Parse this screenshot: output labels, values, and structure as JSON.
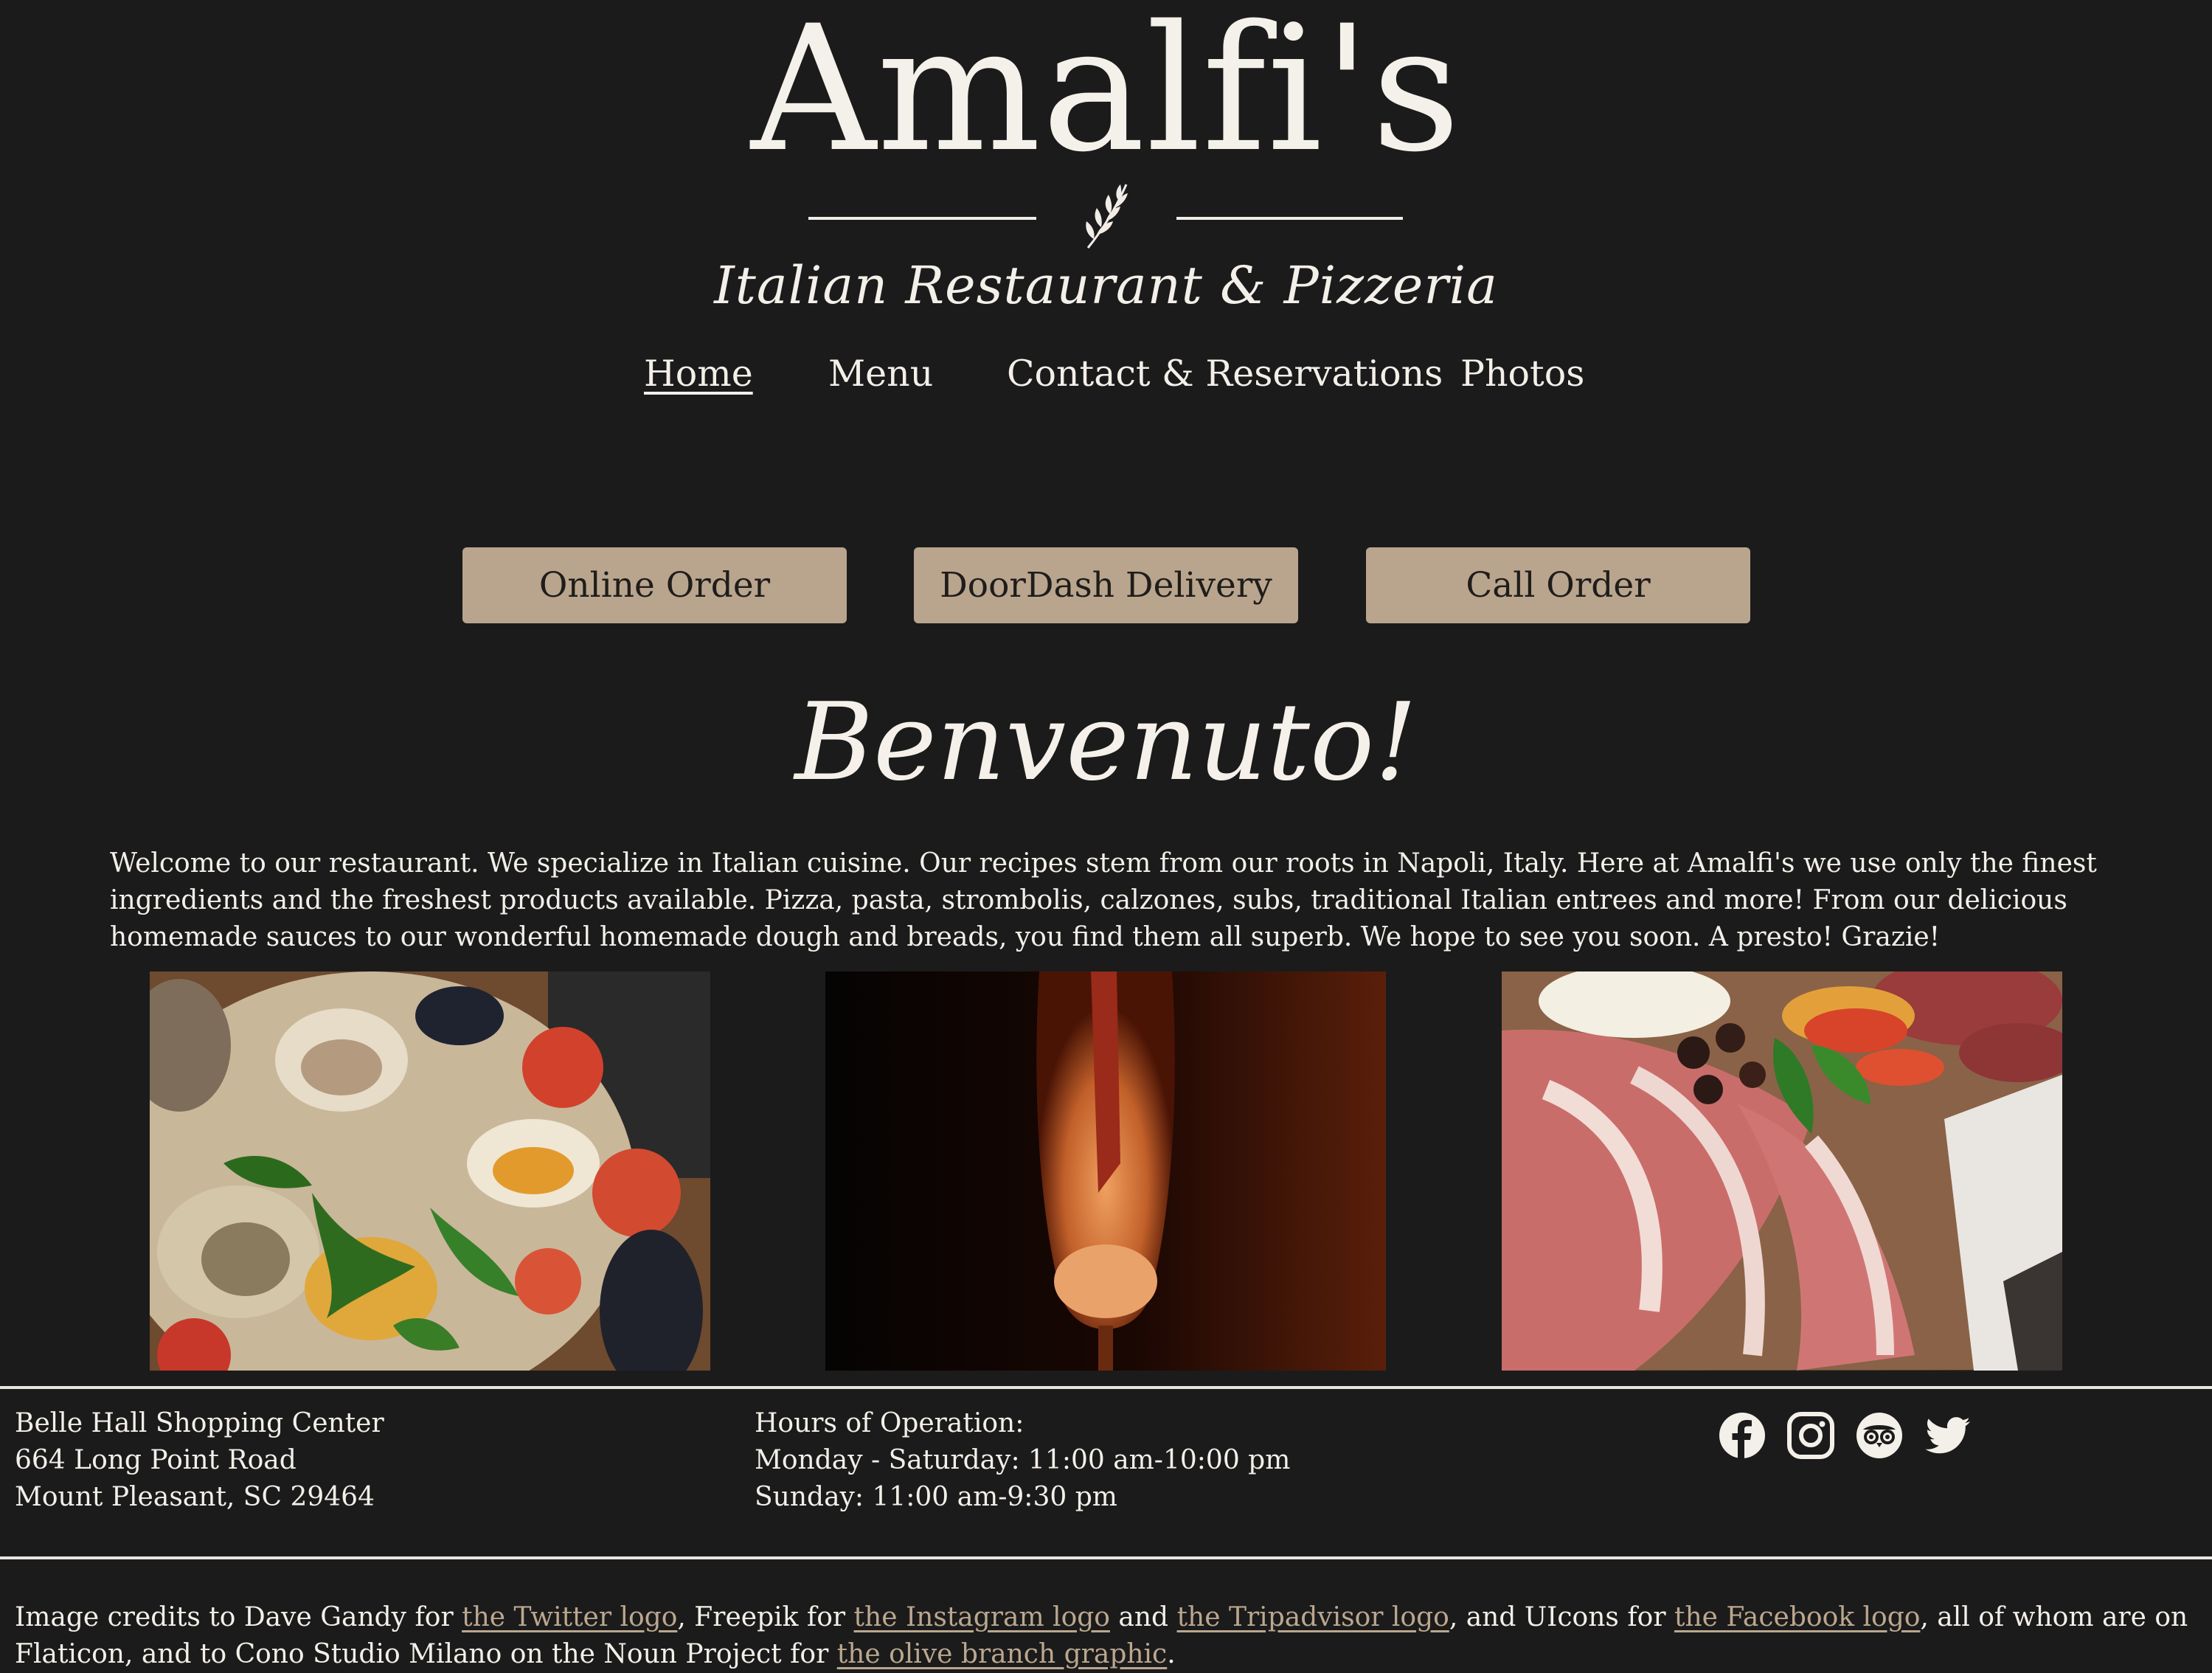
{
  "header": {
    "title": "Amalfi's",
    "tagline": "Italian Restaurant & Pizzeria"
  },
  "nav": {
    "home": "Home",
    "menu": "Menu",
    "contact": "Contact & Reservations",
    "photos": "Photos",
    "active": "Home"
  },
  "order_buttons": {
    "online": "Online Order",
    "doordash": "DoorDash Delivery",
    "call": "Call Order"
  },
  "welcome": {
    "heading": "Benvenuto!",
    "text": "Welcome to our restaurant. We specialize in Italian cuisine. Our recipes stem from our roots in Napoli, Italy. Here at Amalfi's we use only the finest ingredients and the freshest products available. Pizza, pasta, strombolis, calzones, subs, traditional Italian entrees and more! From our delicious homemade sauces to our wonderful homemade dough and breads, you find them all superb. We hope to see you soon. A presto! Grazie!"
  },
  "footer": {
    "address": [
      "Belle Hall Shopping Center",
      "664 Long Point Road",
      "Mount Pleasant, SC 29464"
    ],
    "hours": [
      "Hours of Operation:",
      "Monday - Saturday: 11:00 am-10:00 pm",
      "Sunday: 11:00 am-9:30 pm"
    ],
    "social_icons": [
      "facebook-icon",
      "instagram-icon",
      "tripadvisor-icon",
      "twitter-icon"
    ]
  },
  "credits": {
    "t1": "Image credits to Dave Gandy for ",
    "l1": "the Twitter logo",
    "t2": ", Freepik for ",
    "l2": "the Instagram logo",
    "t3": " and ",
    "l3": "the Tripadvisor logo",
    "t4": ", and UIcons for ",
    "l4": "the Facebook logo",
    "t5": ", all of whom are on Flaticon, and to Cono Studio Milano on the Noun Project for ",
    "l5": "the olive branch graphic",
    "t6": "."
  },
  "colors": {
    "background": "#1b1b1b",
    "button": "#b9a58e",
    "text": "#f3efe9",
    "link": "#bba78f"
  }
}
